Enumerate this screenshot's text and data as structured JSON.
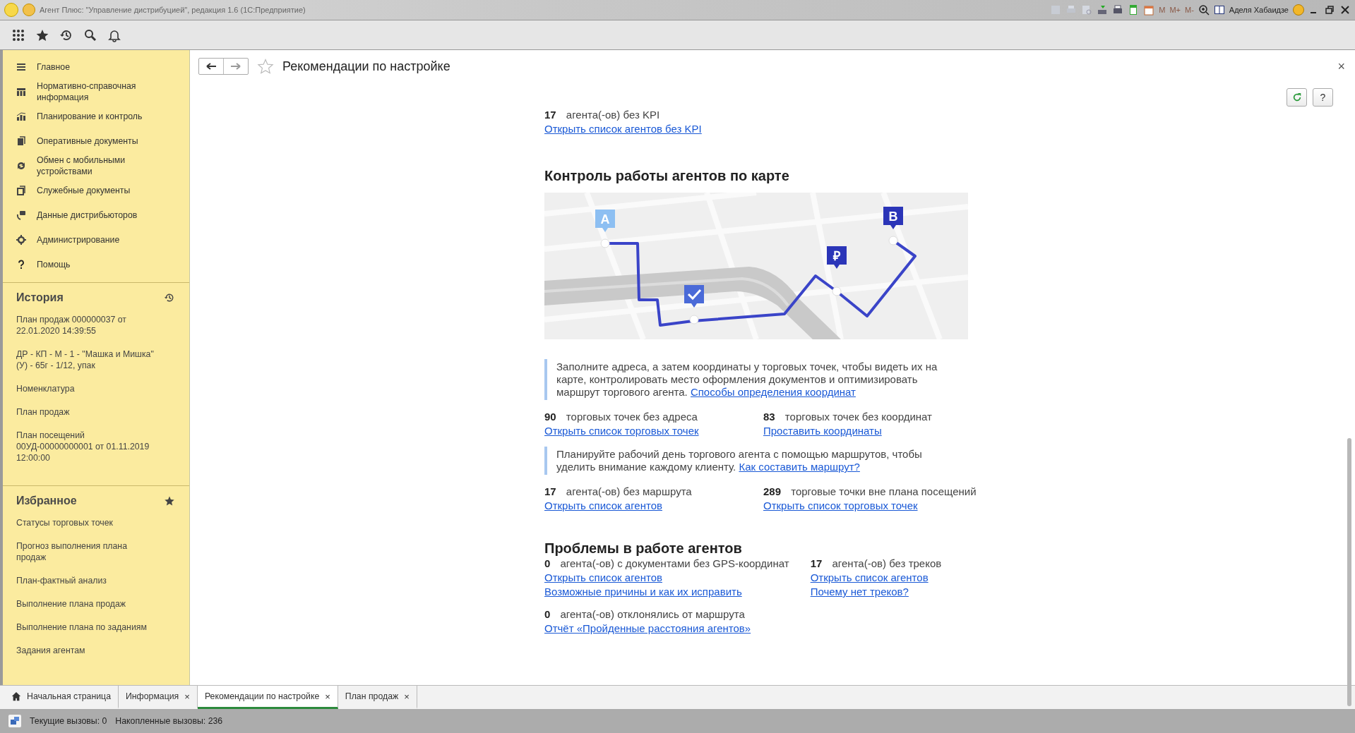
{
  "window": {
    "title": "Агент Плюс: \"Управление дистрибуцией\", редакция 1.6  (1С:Предприятие)",
    "memory_buttons": [
      "M",
      "M+",
      "M-"
    ],
    "user": "Аделя Хабаидзе"
  },
  "sidebar": {
    "nav": [
      "Главное",
      "Нормативно-справочная информация",
      "Планирование и контроль",
      "Оперативные документы",
      "Обмен с мобильными устройствами",
      "Служебные документы",
      "Данные дистрибьюторов",
      "Администрирование",
      "Помощь"
    ],
    "history": {
      "title": "История",
      "items": [
        "План продаж 000000037 от 22.01.2020 14:39:55",
        "ДР - КП - М - 1 - \"Машка и Мишка\" (У) - 65г - 1/12, упак",
        "Номенклатура",
        "План продаж",
        "План посещений 00УД-00000000001 от 01.11.2019 12:00:00"
      ]
    },
    "favorites": {
      "title": "Избранное",
      "items": [
        "Статусы торговых точек",
        "Прогноз выполнения плана продаж",
        "План-фактный анализ",
        "Выполнение плана продаж",
        "Выполнение плана по заданиям",
        "Задания агентам"
      ]
    }
  },
  "form": {
    "title": "Рекомендации по настройке",
    "close": "×",
    "help": "?",
    "blocks": [
      {
        "kind": "stats",
        "items": [
          {
            "count": "17",
            "label": "агента(-ов) без KPI",
            "links": [
              "Открыть список агентов без KPI"
            ]
          }
        ]
      },
      {
        "kind": "heading",
        "text": "Контроль работы агентов по карте"
      },
      {
        "kind": "map",
        "markers": [
          "A",
          "₽",
          "B"
        ]
      },
      {
        "kind": "note",
        "text": "Заполните адреса, а затем координаты у торговых точек, чтобы видеть их на карте, контролировать место оформления документов и оптимизировать маршрут торгового агента.",
        "link": "Способы определения координат"
      },
      {
        "kind": "stats",
        "items": [
          {
            "count": "90",
            "label": "торговых точек без адреса",
            "links": [
              "Открыть список торговых точек"
            ]
          },
          {
            "count": "83",
            "label": "торговых точек без координат",
            "links": [
              "Проставить координаты"
            ]
          }
        ]
      },
      {
        "kind": "note",
        "text": "Планируйте рабочий день торгового агента с помощью маршрутов, чтобы уделить внимание каждому клиенту.",
        "link": "Как составить маршрут?"
      },
      {
        "kind": "stats",
        "items": [
          {
            "count": "17",
            "label": "агента(-ов) без маршрута",
            "links": [
              "Открыть список агентов"
            ]
          },
          {
            "count": "289",
            "label": "торговые точки вне плана посещений",
            "links": [
              "Открыть список торговых точек"
            ]
          }
        ]
      },
      {
        "kind": "heading",
        "text": "Проблемы в работе агентов"
      },
      {
        "kind": "stats",
        "items": [
          {
            "count": "0",
            "label": "агента(-ов) с документами без GPS-координат",
            "links": [
              "Открыть список агентов",
              "Возможные причины и как их исправить"
            ]
          },
          {
            "count": "17",
            "label": "агента(-ов) без треков",
            "links": [
              "Открыть список агентов",
              "Почему нет треков?"
            ]
          }
        ]
      },
      {
        "kind": "stats",
        "items": [
          {
            "count": "0",
            "label": "агента(-ов) отклонялись от маршрута",
            "links": [
              "Отчёт «Пройденные расстояния агентов»"
            ]
          }
        ]
      }
    ]
  },
  "tabs": [
    {
      "kind": "home",
      "label": "Начальная страница",
      "selected": false
    },
    {
      "kind": "document",
      "label": "Информация",
      "selected": false
    },
    {
      "kind": "document",
      "label": "Рекомендации по настройке",
      "selected": true
    },
    {
      "kind": "document",
      "label": "План продаж",
      "selected": false
    }
  ],
  "tab_close": "×",
  "status": {
    "current": "Текущие вызовы: 0",
    "accumulated": "Накопленные вызовы: 236"
  }
}
